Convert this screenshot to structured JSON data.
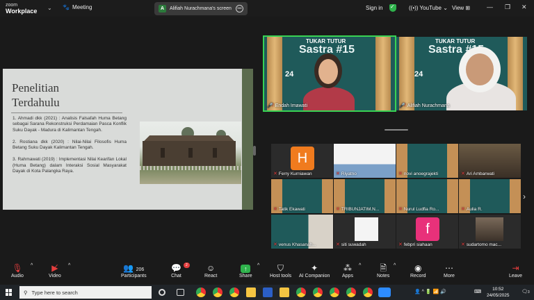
{
  "topbar": {
    "brand_line1": "zoom",
    "brand_line2": "Workplace",
    "meeting_label": "Meeting",
    "screen_share_label": "Alifiah Nurachmana's screen",
    "screen_share_avatar": "A",
    "sign_in": "Sign in",
    "youtube_label": "YouTube",
    "view_label": "View"
  },
  "slide": {
    "title": "Penelitian Terdahulu",
    "items": [
      "1. Ahmadi dkk (2021) : Analisis Falsafah Huma Betang sebagai Sarana Rekonstruksi Perdamaian Pasca Konflik Suku Dayak - Madura di Kalimantan Tengah.",
      "2. Rostiana dkk (2020) : Nilai-Nilai Filosofis Huma Betang Suku Dayak Kalimantan Tengah.",
      "3. Rahmawati (2019) : Implementasi Nilai Kearifan Lokal (Huma Betang) dalam Interaksi Sosial Masyarakat Dayak di Kota Palangka Raya."
    ]
  },
  "speakers": [
    {
      "name": "Endah Imawati",
      "active": true
    },
    {
      "name": "Alifiah Nurachmana",
      "active": false
    }
  ],
  "event_banner": {
    "line1": "TUKAR TUTUR",
    "line2": "Sastra #15",
    "date": "24"
  },
  "participants_grid": [
    {
      "name": "Ferry Kurniawan",
      "letter": "H",
      "letter_color": "#f07b1e",
      "muted": true
    },
    {
      "name": "Riyatno",
      "muted": true
    },
    {
      "name": "novi anoegrajekti",
      "muted": true
    },
    {
      "name": "Ari Ambarwati",
      "muted": true
    },
    {
      "name": "Tatik Ekawati",
      "muted": true
    },
    {
      "name": "TRIBUNJATIM.N...",
      "muted": true
    },
    {
      "name": "Nurul Ludfia Ro...",
      "muted": true
    },
    {
      "name": "Aulia R.",
      "muted": true
    },
    {
      "name": "venus Khasanah...",
      "muted": true
    },
    {
      "name": "siti suwadah",
      "muted": true
    },
    {
      "name": "febpri siahaan",
      "letter": "f",
      "letter_color": "#e8317a",
      "muted": true
    },
    {
      "name": "sudartomo mac...",
      "muted": true
    }
  ],
  "toolbar": {
    "audio": "Audio",
    "video": "Video",
    "participants": "Participants",
    "participants_count": "206",
    "chat": "Chat",
    "chat_badge": "2",
    "react": "React",
    "share": "Share",
    "host_tools": "Host tools",
    "ai_companion": "AI Companion",
    "apps": "Apps",
    "notes": "Notes",
    "record": "Record",
    "more": "More",
    "leave": "Leave"
  },
  "taskbar": {
    "search_placeholder": "Type here to search",
    "time": "10:52",
    "date": "24/05/2025",
    "notification_count": "3"
  },
  "colors": {
    "active_speaker_border": "#39d353",
    "share_green": "#2fb24c",
    "leave_red": "#e53e3e",
    "banner_teal": "#1f5a5a"
  }
}
